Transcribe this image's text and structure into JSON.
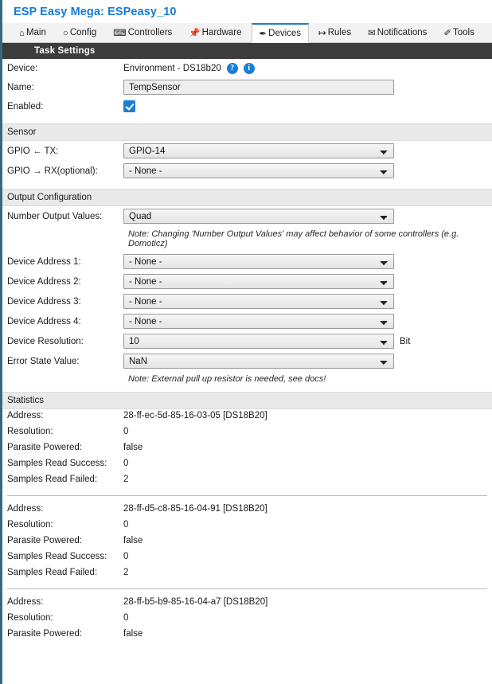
{
  "app": {
    "title": "ESP Easy Mega: ESPeasy_10"
  },
  "tabs": [
    {
      "label": "Main",
      "icon": "home-icon",
      "glyph": "⌂",
      "active": false
    },
    {
      "label": "Config",
      "icon": "gear-icon",
      "glyph": "○",
      "active": false
    },
    {
      "label": "Controllers",
      "icon": "chat-icon",
      "glyph": "⌨",
      "active": false
    },
    {
      "label": "Hardware",
      "icon": "pushpin-icon",
      "glyph": "📌",
      "active": false
    },
    {
      "label": "Devices",
      "icon": "plug-icon",
      "glyph": "✒",
      "active": true
    },
    {
      "label": "Rules",
      "icon": "arrow-branch-icon",
      "glyph": "↦",
      "active": false
    },
    {
      "label": "Notifications",
      "icon": "envelope-icon",
      "glyph": "✉",
      "active": false
    },
    {
      "label": "Tools",
      "icon": "pencil-icon",
      "glyph": "✐",
      "active": false
    }
  ],
  "task_settings": {
    "header": "Task Settings",
    "device_label": "Device:",
    "device_value": "Environment - DS18b20",
    "help_icon_glyph": "?",
    "info_icon_glyph": "i",
    "name_label": "Name:",
    "name_value": "TempSensor",
    "name_placeholder": "",
    "enabled_label": "Enabled:",
    "enabled_checked": true
  },
  "sensor": {
    "header": "Sensor",
    "tx_label": "GPIO ← TX:",
    "tx_value": "GPIO-14",
    "rx_label": "GPIO → RX(optional):",
    "rx_value": "- None -"
  },
  "output_configuration": {
    "header": "Output Configuration",
    "number_output_values_label": "Number Output Values:",
    "number_output_values_value": "Quad",
    "number_output_note": "Note: Changing 'Number Output Values' may affect behavior of some controllers (e.g. Domoticz)",
    "addresses": [
      {
        "label": "Device Address 1:",
        "value": "- None -"
      },
      {
        "label": "Device Address 2:",
        "value": "- None -"
      },
      {
        "label": "Device Address 3:",
        "value": "- None -"
      },
      {
        "label": "Device Address 4:",
        "value": "- None -"
      }
    ],
    "resolution_label": "Device Resolution:",
    "resolution_value": "10",
    "resolution_unit": "Bit",
    "error_state_label": "Error State Value:",
    "error_state_value": "NaN",
    "pullup_note": "Note: External pull up resistor is needed, see docs!"
  },
  "statistics": {
    "header": "Statistics",
    "labels": {
      "address": "Address:",
      "resolution": "Resolution:",
      "parasite": "Parasite Powered:",
      "success": "Samples Read Success:",
      "failed": "Samples Read Failed:"
    },
    "blocks": [
      {
        "address": "28-ff-ec-5d-85-16-03-05 [DS18B20]",
        "resolution": "0",
        "parasite": "false",
        "success": "0",
        "failed": "2"
      },
      {
        "address": "28-ff-d5-c8-85-16-04-91 [DS18B20]",
        "resolution": "0",
        "parasite": "false",
        "success": "0",
        "failed": "2"
      },
      {
        "address": "28-ff-b5-b9-85-16-04-a7 [DS18B20]",
        "resolution": "0",
        "parasite": "false",
        "success": "",
        "failed": ""
      }
    ]
  },
  "colors": {
    "accent_blue": "#157ad6",
    "tab_active_border": "#1f7fc4",
    "dark_bar": "#3c3c3c",
    "light_bar": "#e9e9e9",
    "edge_stripe": "#316b82"
  }
}
